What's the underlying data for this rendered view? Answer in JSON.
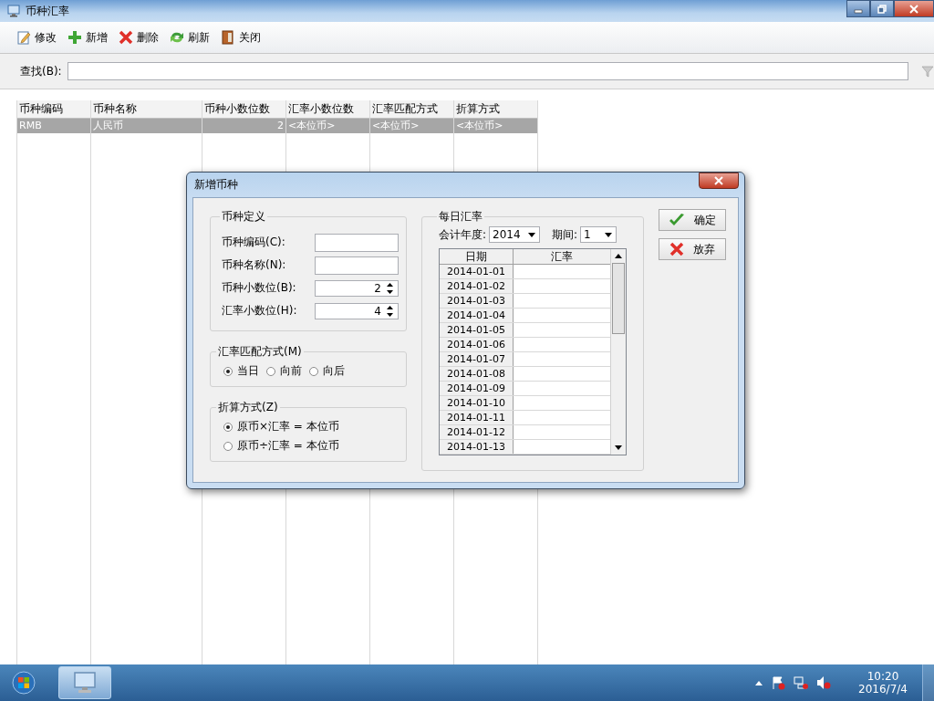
{
  "window": {
    "title": "币种汇率"
  },
  "toolbar": [
    {
      "label": "修改",
      "kind": "edit"
    },
    {
      "label": "新增",
      "kind": "add"
    },
    {
      "label": "删除",
      "kind": "delete"
    },
    {
      "label": "刷新",
      "kind": "refresh"
    },
    {
      "label": "关闭",
      "kind": "close"
    }
  ],
  "search": {
    "label": "查找(B):"
  },
  "table": {
    "columns": [
      "币种编码",
      "币种名称",
      "币种小数位数",
      "汇率小数位数",
      "汇率匹配方式",
      "折算方式"
    ],
    "rows": [
      {
        "selected": true,
        "cells": [
          "RMB",
          "人民币",
          "2",
          "<本位币>",
          "<本位币>",
          "<本位币>"
        ]
      }
    ]
  },
  "dialog": {
    "title": "新增币种",
    "definition": {
      "title": "币种定义",
      "fields": [
        {
          "label": "币种编码(C):",
          "kind": "text"
        },
        {
          "label": "币种名称(N):",
          "kind": "text"
        },
        {
          "label": "币种小数位(B):",
          "kind": "spin",
          "value": "2"
        },
        {
          "label": "汇率小数位(H):",
          "kind": "spin",
          "value": "4"
        }
      ]
    },
    "match": {
      "title": "汇率匹配方式(M)",
      "options": [
        {
          "label": "当日",
          "selected": true
        },
        {
          "label": "向前",
          "selected": false
        },
        {
          "label": "向后",
          "selected": false
        }
      ]
    },
    "conversion": {
      "title": "折算方式(Z)",
      "options": [
        {
          "label": "原币×汇率 = 本位币",
          "selected": true
        },
        {
          "label": "原币÷汇率 = 本位币",
          "selected": false
        }
      ]
    },
    "daily": {
      "title": "每日汇率",
      "year_label": "会计年度:",
      "year": "2014",
      "period_label": "期间:",
      "period": "1",
      "columns": [
        "日期",
        "汇率"
      ],
      "rows": [
        "2014-01-01",
        "2014-01-02",
        "2014-01-03",
        "2014-01-04",
        "2014-01-05",
        "2014-01-06",
        "2014-01-07",
        "2014-01-08",
        "2014-01-09",
        "2014-01-10",
        "2014-01-11",
        "2014-01-12",
        "2014-01-13"
      ]
    },
    "buttons": [
      {
        "label": "确定",
        "kind": "ok"
      },
      {
        "label": "放弃",
        "kind": "cancel"
      }
    ]
  },
  "taskbar": {
    "time": "10:20",
    "date": "2016/7/4"
  }
}
